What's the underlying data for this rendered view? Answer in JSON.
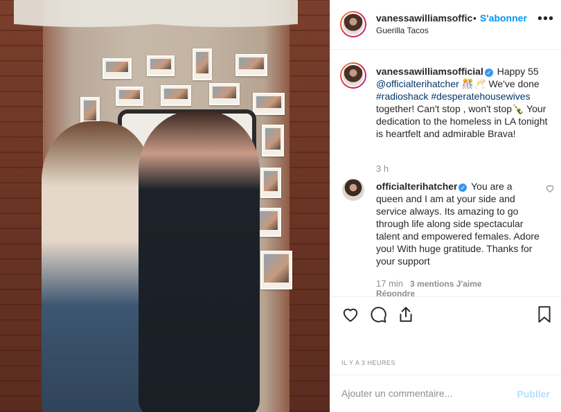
{
  "header": {
    "username": "vanessawilliamsoffic",
    "separator": "•",
    "follow_label": "S'abonner",
    "location": "Guerilla Tacos",
    "more_label": "•••"
  },
  "caption": {
    "username": "vanessawilliamsofficial",
    "verified_mark": "✓",
    "text_1": " Happy 55 ",
    "mention": "@officialterihatcher",
    "text_2": " 🎊🥂 We've done ",
    "hashtag_1": "#radioshack",
    "hashtag_2": "#desperatehousewives",
    "text_3": " together! Can't stop , won't stop🍾 Your dedication to the homeless in LA tonight is heartfelt and admirable Brava!",
    "time": "3 h"
  },
  "comment": {
    "username": "officialterihatcher",
    "verified_mark": "✓",
    "text": " You are a queen and I am at your side and service always. Its amazing to go through life along side spectacular talent and empowered females. Adore you! With huge gratitude. Thanks for your support",
    "time": "17 min",
    "likes": "3 mentions J'aime",
    "reply": "Répondre"
  },
  "post": {
    "timestamp": "IL Y A 3 HEURES"
  },
  "add_comment": {
    "placeholder": "Ajouter un commentaire...",
    "publish_label": "Publier"
  },
  "icons": {
    "like": "heart-icon",
    "comment": "comment-icon",
    "share": "share-icon",
    "save": "bookmark-icon",
    "more": "more-icon"
  },
  "colors": {
    "accent": "#0095f6",
    "link": "#00376b",
    "muted": "#8e8e8e",
    "verified": "#3897f0",
    "publish_disabled": "#b2dffc"
  }
}
